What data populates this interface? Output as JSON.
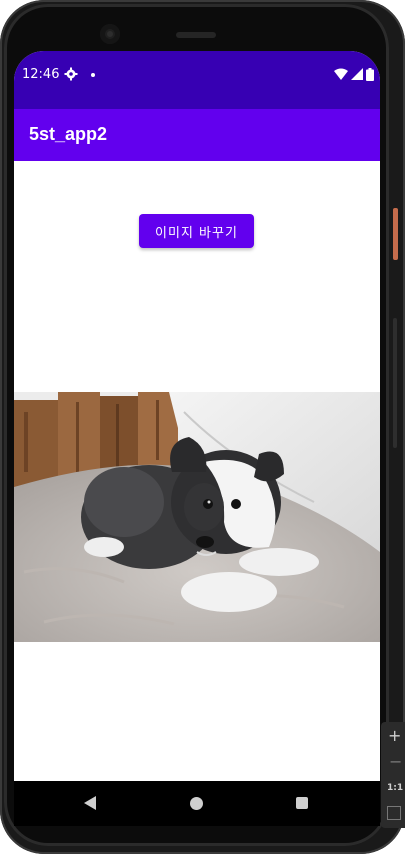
{
  "status_bar": {
    "time": "12:46",
    "icons": [
      "settings-icon",
      "notification-dot-icon",
      "wifi-icon",
      "cell-signal-icon",
      "battery-icon"
    ]
  },
  "app_bar": {
    "title": "5st_app2",
    "color": "#6200ee"
  },
  "main": {
    "change_image_button_label": "이미지 바꾸기",
    "image_subject": "black and white puppy lying on a shaggy rug"
  },
  "nav_bar": {
    "icons": [
      "back-icon",
      "home-icon",
      "recents-icon"
    ]
  },
  "emulator_controls": {
    "zoom_in": "+",
    "zoom_out": "−",
    "ratio": "1:1"
  },
  "colors": {
    "status_bar": "#3700b3",
    "primary": "#6200ee"
  }
}
